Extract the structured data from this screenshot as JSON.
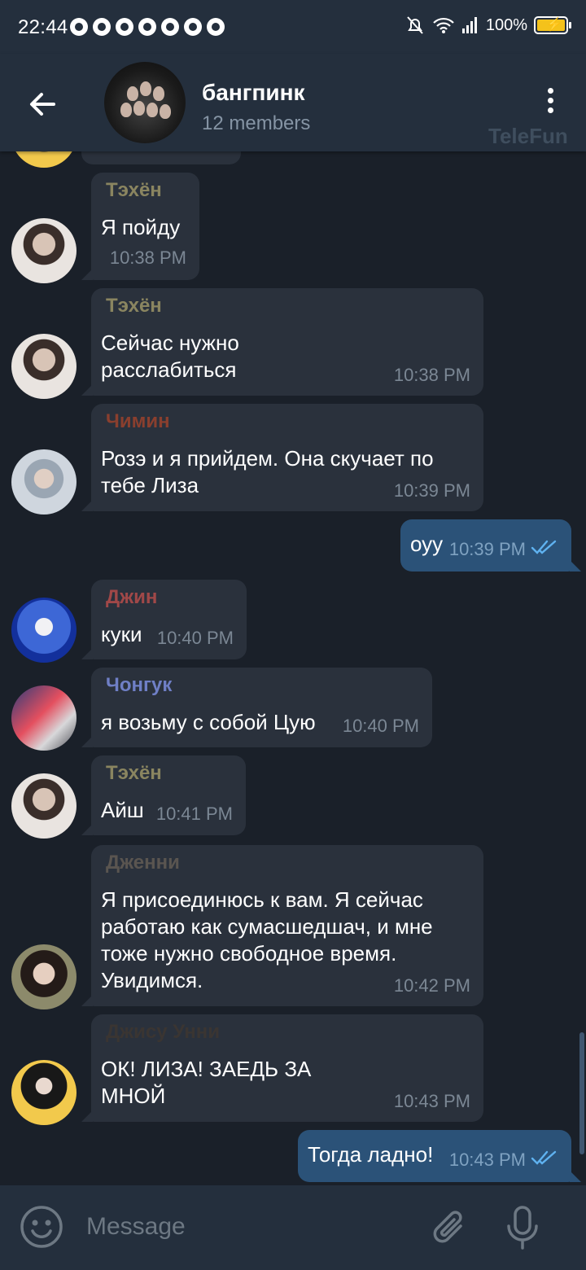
{
  "status_bar": {
    "time": "22:44",
    "battery": "100%"
  },
  "header": {
    "title": "бангпинк",
    "subtitle": "12 members",
    "watermark": "TeleFun"
  },
  "messages": [
    {
      "sender": "Тэхён",
      "sender_color": "#8a8560",
      "text": "Я пойду",
      "time": "10:38 PM"
    },
    {
      "sender": "Тэхён",
      "sender_color": "#8a8560",
      "text": "Сейчас нужно\nрасслабиться",
      "time": "10:38 PM"
    },
    {
      "sender": "Чимин",
      "sender_color": "#8a3f2e",
      "text": "Розэ и я прийдем.  Она скучает по\nтебе Лиза",
      "time": "10:39 PM"
    },
    {
      "text": "оуу",
      "time": "10:39 PM",
      "outgoing": true
    },
    {
      "sender": "Джин",
      "sender_color": "#a04848",
      "text": "куки",
      "time": "10:40 PM"
    },
    {
      "sender": "Чонгук",
      "sender_color": "#6f7fc6",
      "text": "я возьму с собой Цую",
      "time": "10:40 PM"
    },
    {
      "sender": "Тэхён",
      "sender_color": "#8a8560",
      "text": "Айш",
      "time": "10:41 PM"
    },
    {
      "sender": "Дженни",
      "sender_color": "#5a5550",
      "text": "Я присоединюсь к вам. Я сейчас\nработаю как сумасшедшач, и мне\nтоже нужно свободное время.\nУвидимся.",
      "time": "10:42 PM"
    },
    {
      "sender": "Джису Унни",
      "sender_color": "#3a3532",
      "text": "ОК! ЛИЗА! ЗАЕДЬ ЗА\nМНОЙ",
      "time": "10:43 PM"
    },
    {
      "text": "Тогда ладно!",
      "time": "10:43 PM",
      "outgoing": true
    }
  ],
  "input": {
    "placeholder": "Message"
  },
  "colors": {
    "background": "#1a2029",
    "bar": "#242f3d",
    "incoming": "#2a313c",
    "outgoing": "#2b5278",
    "tick": "#5fb2f0"
  }
}
